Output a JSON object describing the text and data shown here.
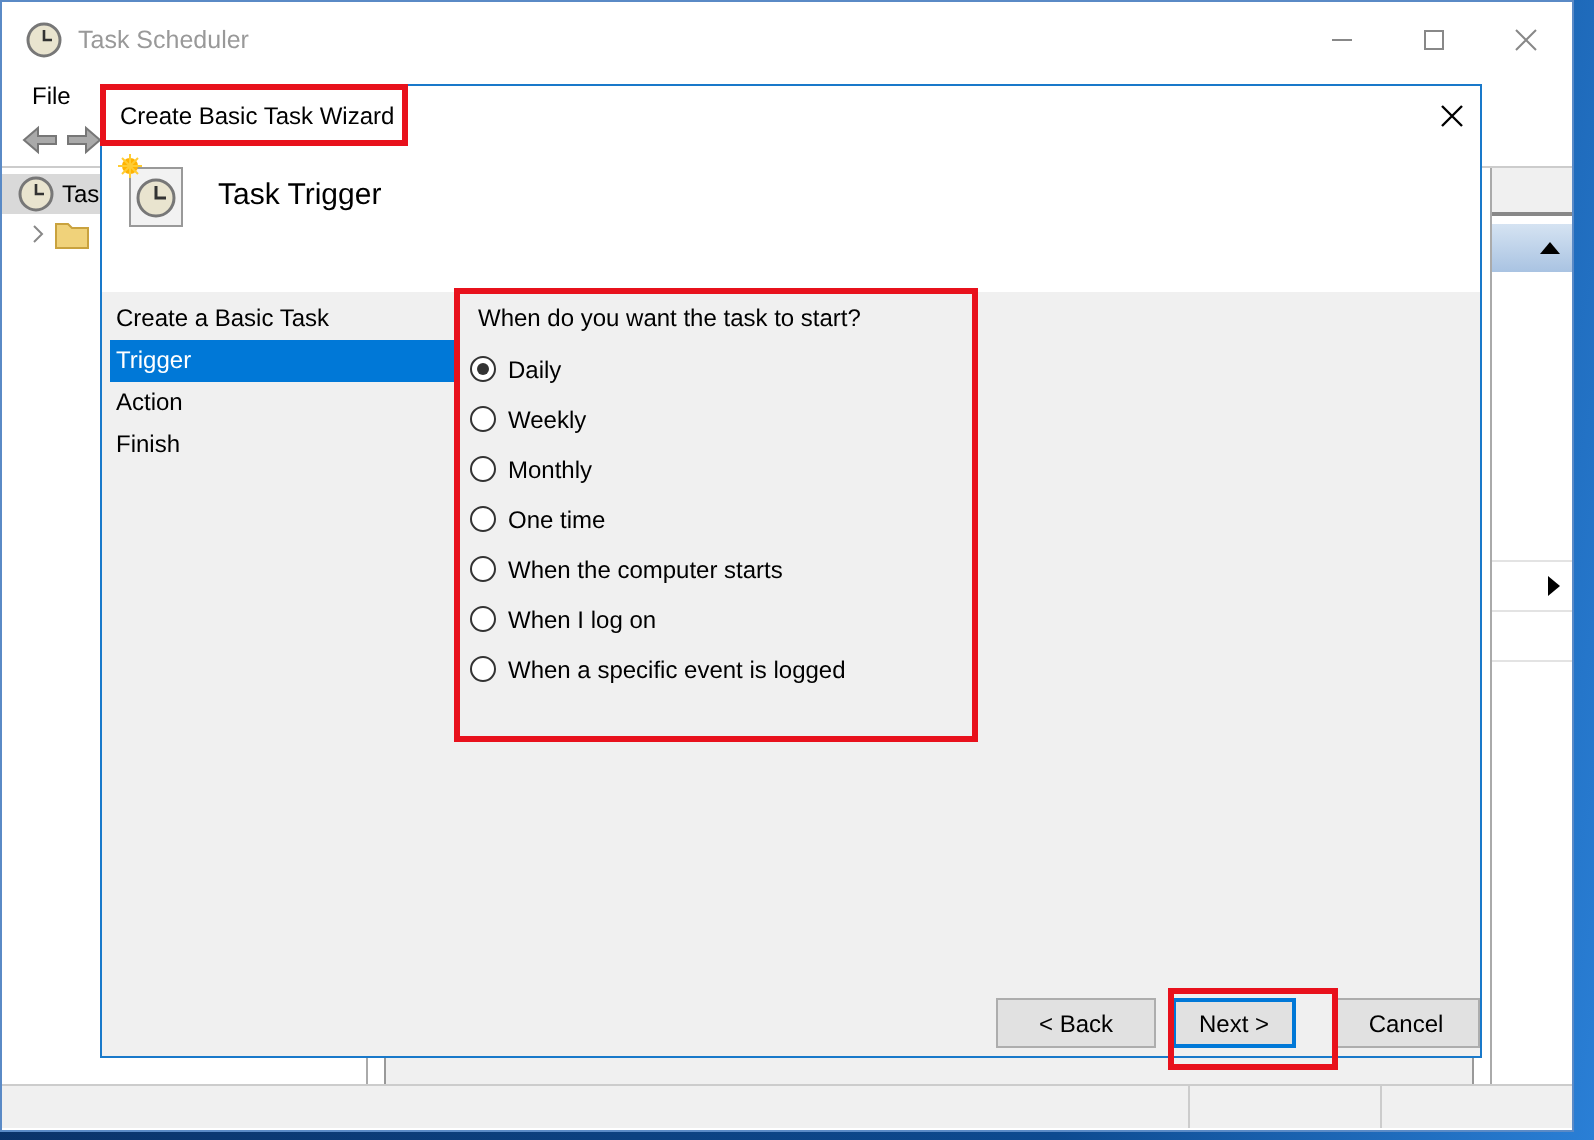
{
  "main_window": {
    "title": "Task Scheduler",
    "menu": [
      "File"
    ],
    "tree_item": "Tas"
  },
  "dialog": {
    "title": "Create Basic Task Wizard",
    "header": "Task Trigger",
    "steps": [
      {
        "label": "Create a Basic Task",
        "selected": false
      },
      {
        "label": "Trigger",
        "selected": true
      },
      {
        "label": "Action",
        "selected": false
      },
      {
        "label": "Finish",
        "selected": false
      }
    ],
    "question": "When do you want the task to start?",
    "options": [
      {
        "label": "Daily",
        "selected": true
      },
      {
        "label": "Weekly",
        "selected": false
      },
      {
        "label": "Monthly",
        "selected": false
      },
      {
        "label": "One time",
        "selected": false
      },
      {
        "label": "When the computer starts",
        "selected": false
      },
      {
        "label": "When I log on",
        "selected": false
      },
      {
        "label": "When a specific event is logged",
        "selected": false
      }
    ],
    "buttons": [
      {
        "label": "< Back",
        "default": false
      },
      {
        "label": "Next >",
        "default": true
      },
      {
        "label": "Cancel",
        "default": false
      }
    ]
  }
}
